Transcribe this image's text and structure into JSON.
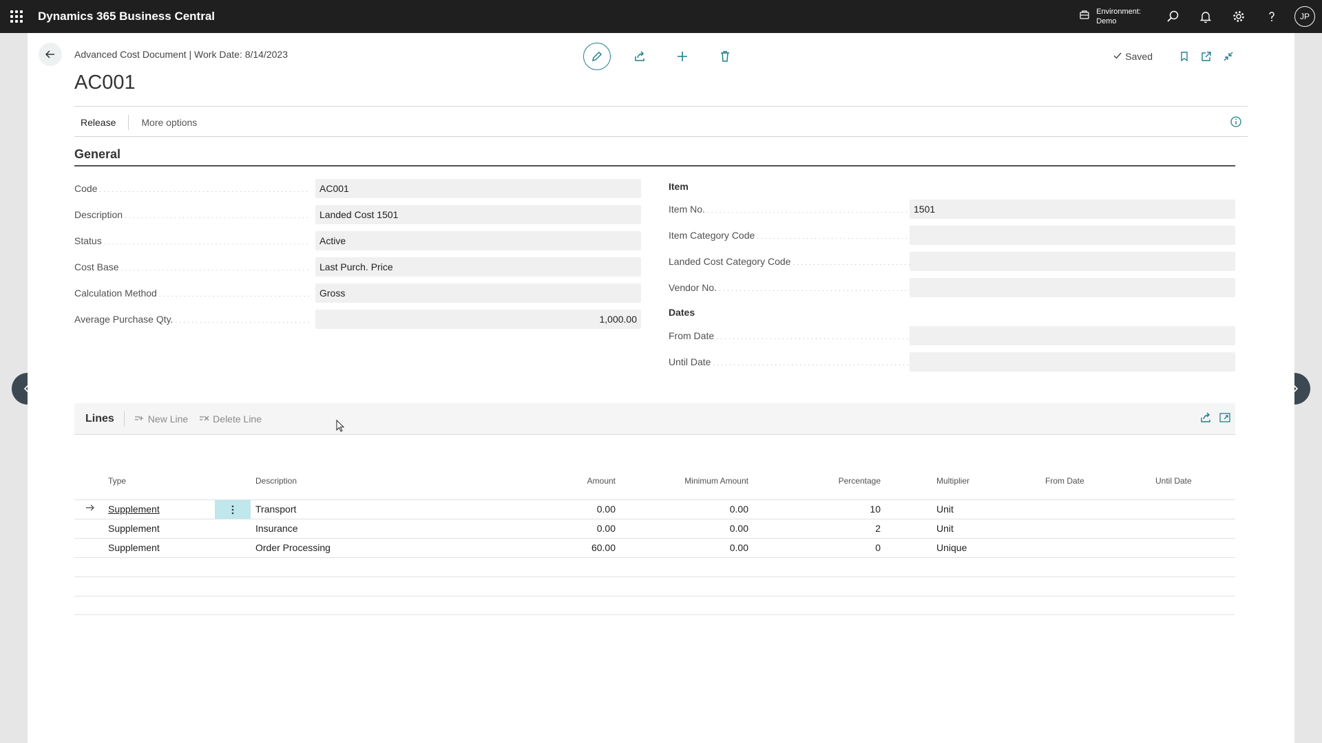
{
  "app": {
    "title": "Dynamics 365 Business Central",
    "environment_label": "Environment:",
    "environment_value": "Demo",
    "user_initials": "JP"
  },
  "header": {
    "breadcrumb": "Advanced Cost Document | Work Date: 8/14/2023",
    "title": "AC001",
    "saved_label": "Saved"
  },
  "actionbar": {
    "release": "Release",
    "more_options": "More options"
  },
  "general": {
    "title": "General",
    "left_fields": [
      {
        "label": "Code",
        "value": "AC001"
      },
      {
        "label": "Description",
        "value": "Landed Cost 1501"
      },
      {
        "label": "Status",
        "value": "Active"
      },
      {
        "label": "Cost Base",
        "value": "Last Purch. Price"
      },
      {
        "label": "Calculation Method",
        "value": "Gross"
      },
      {
        "label": "Average Purchase Qty.",
        "value": "1,000.00"
      }
    ],
    "item_section": "Item",
    "item_fields": [
      {
        "label": "Item No.",
        "value": "1501"
      },
      {
        "label": "Item Category Code",
        "value": ""
      },
      {
        "label": "Landed Cost Category Code",
        "value": ""
      },
      {
        "label": "Vendor No.",
        "value": ""
      }
    ],
    "dates_section": "Dates",
    "date_fields": [
      {
        "label": "From Date",
        "value": ""
      },
      {
        "label": "Until Date",
        "value": ""
      }
    ]
  },
  "lines": {
    "title": "Lines",
    "new_line": "New Line",
    "delete_line": "Delete Line",
    "columns": {
      "type": "Type",
      "description": "Description",
      "amount": "Amount",
      "minimum_amount": "Minimum Amount",
      "percentage": "Percentage",
      "multiplier": "Multiplier",
      "from_date": "From Date",
      "until_date": "Until Date"
    },
    "rows": [
      {
        "type": "Supplement",
        "description": "Transport",
        "amount": "0.00",
        "minimum_amount": "0.00",
        "percentage": "10",
        "multiplier": "Unit",
        "from_date": "",
        "until_date": ""
      },
      {
        "type": "Supplement",
        "description": "Insurance",
        "amount": "0.00",
        "minimum_amount": "0.00",
        "percentage": "2",
        "multiplier": "Unit",
        "from_date": "",
        "until_date": ""
      },
      {
        "type": "Supplement",
        "description": "Order Processing",
        "amount": "60.00",
        "minimum_amount": "0.00",
        "percentage": "0",
        "multiplier": "Unique",
        "from_date": "",
        "until_date": ""
      }
    ]
  },
  "colors": {
    "topbar": "#1f1f1f",
    "accent": "#1f7f8b",
    "selected_cell": "#bfe7ec",
    "nav_button": "#3c4952"
  }
}
